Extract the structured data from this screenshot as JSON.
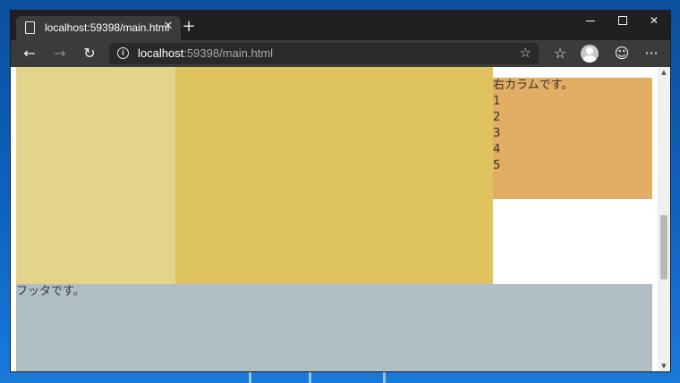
{
  "browser": {
    "tab_title": "localhost:59398/main.html",
    "tab_close_glyph": "✕",
    "new_tab_glyph": "+",
    "url_host": "localhost",
    "url_rest": ":59398/main.html",
    "info_glyph": "i",
    "window_controls": {
      "minimize": "",
      "maximize": "",
      "close": "✕"
    },
    "icons": {
      "back": "←",
      "forward": "→",
      "refresh": "↻",
      "star": "☆",
      "favorites": "☆",
      "smile": "☺",
      "more": "···"
    }
  },
  "page": {
    "right_column": {
      "text": "右カラムです。",
      "items": [
        "1",
        "2",
        "3",
        "4",
        "5"
      ]
    },
    "footer_text": "フッタです。"
  },
  "colors": {
    "left_column": "#e2d58b",
    "main_column": "#dec35f",
    "right_column": "#e2ad64",
    "footer": "#b2bec5"
  }
}
